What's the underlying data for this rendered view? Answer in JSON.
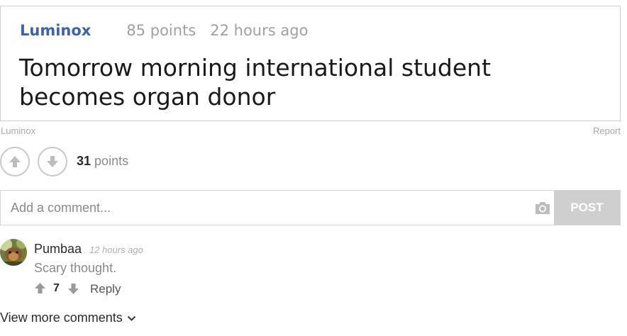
{
  "post": {
    "author": "Luminox",
    "points": "85 points",
    "time": "22 hours ago",
    "title": "Tomorrow morning international student becomes organ donor"
  },
  "source": {
    "label": "Luminox",
    "report": "Report"
  },
  "votes": {
    "count": "31",
    "label": "points"
  },
  "comment_form": {
    "placeholder": "Add a comment...",
    "post_label": "POST"
  },
  "comments": [
    {
      "author": "Pumbaa",
      "time": "12 hours ago",
      "text": "Scary thought.",
      "votes": "7",
      "reply_label": "Reply"
    }
  ],
  "view_more": "View more comments",
  "icons": {
    "upvote": "arrow-up-icon",
    "downvote": "arrow-down-icon",
    "camera": "camera-icon",
    "chevron": "chevron-down-icon"
  },
  "colors": {
    "author_link": "#3a64ad",
    "muted_text": "#a0a0a0",
    "border": "#cfcfcf",
    "post_button_bg": "#cfcfcf"
  }
}
